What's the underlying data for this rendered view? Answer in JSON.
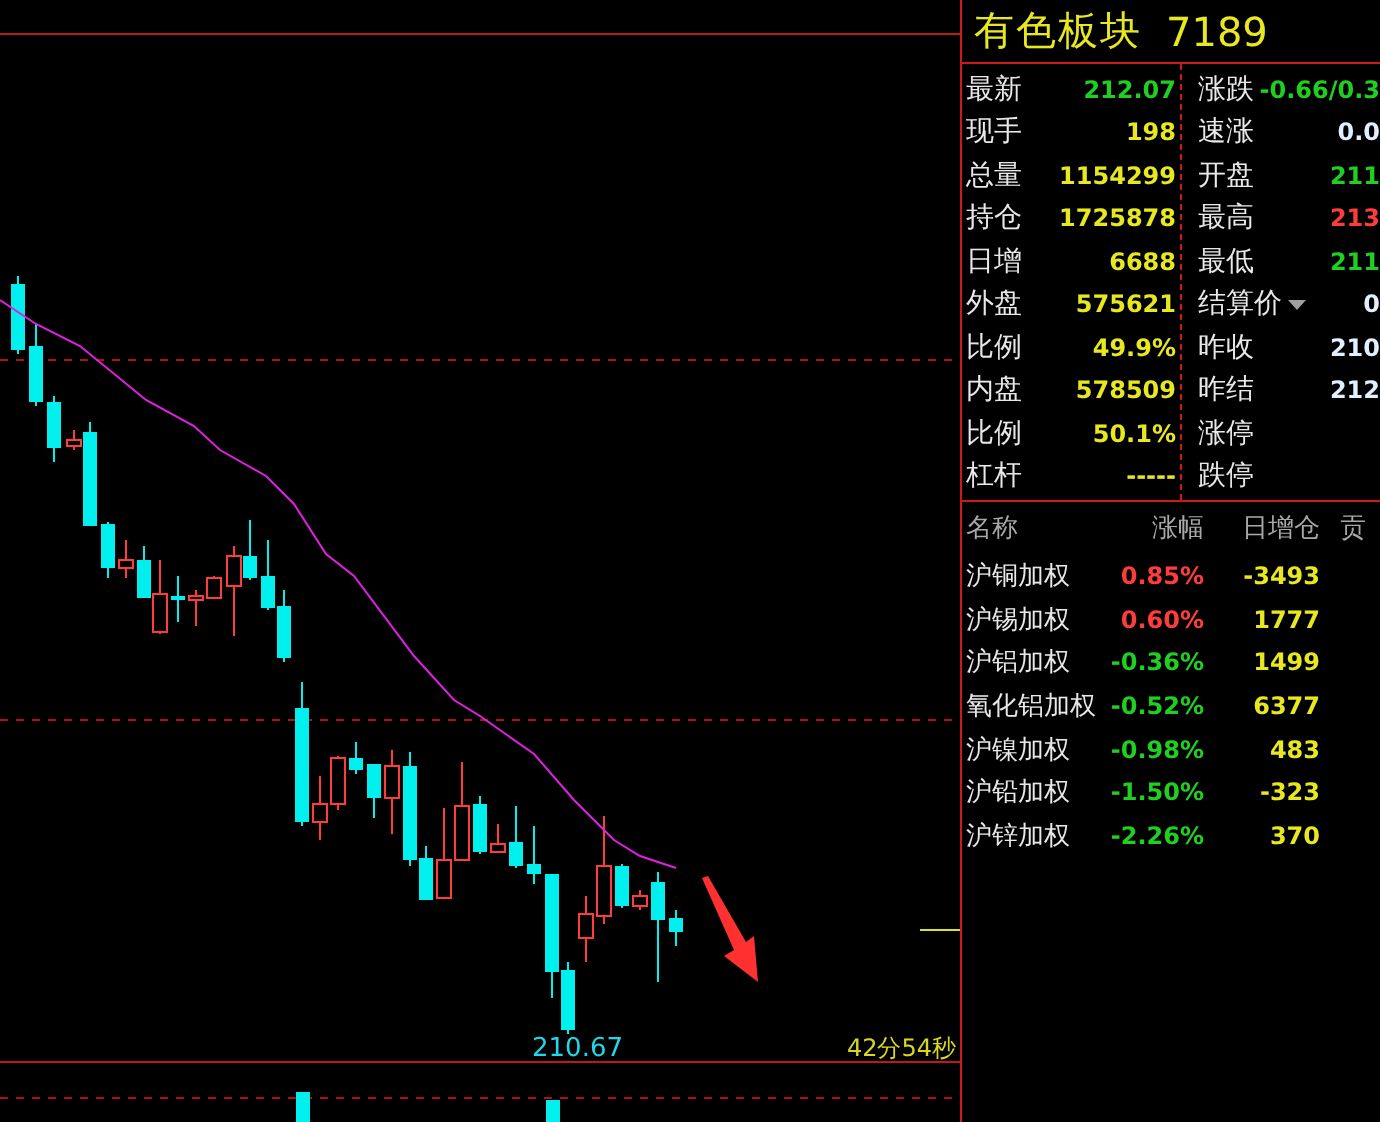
{
  "chart": {
    "low_label": "210.67",
    "countdown": "42分54秒"
  },
  "panel": {
    "title": "有色板块",
    "code": "7189"
  },
  "quote_left": [
    {
      "label": "最新",
      "value": "212.07",
      "color": "#20d020"
    },
    {
      "label": "现手",
      "value": "198",
      "color": "#e8e820"
    },
    {
      "label": "总量",
      "value": "1154299",
      "color": "#e8e820"
    },
    {
      "label": "持仓",
      "value": "1725878",
      "color": "#e8e820"
    },
    {
      "label": "日增",
      "value": "6688",
      "color": "#e8e820"
    },
    {
      "label": "外盘",
      "value": "575621",
      "color": "#e8e820"
    },
    {
      "label": "比例",
      "value": "49.9%",
      "color": "#e8e820"
    },
    {
      "label": "内盘",
      "value": "578509",
      "color": "#e8e820"
    },
    {
      "label": "比例",
      "value": "50.1%",
      "color": "#e8e820"
    },
    {
      "label": "杠杆",
      "value": "-----",
      "color": "#e8e820"
    }
  ],
  "quote_right": [
    {
      "label": "涨跌",
      "value": "-0.66/0.3",
      "color": "#20d020",
      "menu": false
    },
    {
      "label": "速涨",
      "value": "0.0",
      "color": "#e0f0ff",
      "menu": false
    },
    {
      "label": "开盘",
      "value": "211",
      "color": "#20d020",
      "menu": false
    },
    {
      "label": "最高",
      "value": "213",
      "color": "#ff3c3c",
      "menu": false
    },
    {
      "label": "最低",
      "value": "211",
      "color": "#20d020",
      "menu": false
    },
    {
      "label": "结算价",
      "value": "0",
      "color": "#e0f0ff",
      "menu": true
    },
    {
      "label": "昨收",
      "value": "210",
      "color": "#e0f0ff",
      "menu": false
    },
    {
      "label": "昨结",
      "value": "212",
      "color": "#e0f0ff",
      "menu": false
    },
    {
      "label": "涨停",
      "menu": false
    },
    {
      "label": "跌停",
      "menu": false
    }
  ],
  "table": {
    "columns": [
      "名称",
      "涨幅",
      "日增仓",
      "贡"
    ],
    "rows": [
      {
        "name": "沪铜加权",
        "change": "0.85%",
        "color": "#ff3c3c",
        "oi_change": "-3493"
      },
      {
        "name": "沪锡加权",
        "change": "0.60%",
        "color": "#ff3c3c",
        "oi_change": "1777"
      },
      {
        "name": "沪铝加权",
        "change": "-0.36%",
        "color": "#20d020",
        "oi_change": "1499"
      },
      {
        "name": "氧化铝加权",
        "change": "-0.52%",
        "color": "#20d020",
        "oi_change": "6377"
      },
      {
        "name": "沪镍加权",
        "change": "-0.98%",
        "color": "#20d020",
        "oi_change": "483"
      },
      {
        "name": "沪铅加权",
        "change": "-1.50%",
        "color": "#20d020",
        "oi_change": "-323"
      },
      {
        "name": "沪锌加权",
        "change": "-2.26%",
        "color": "#20d020",
        "oi_change": "370"
      }
    ]
  }
}
